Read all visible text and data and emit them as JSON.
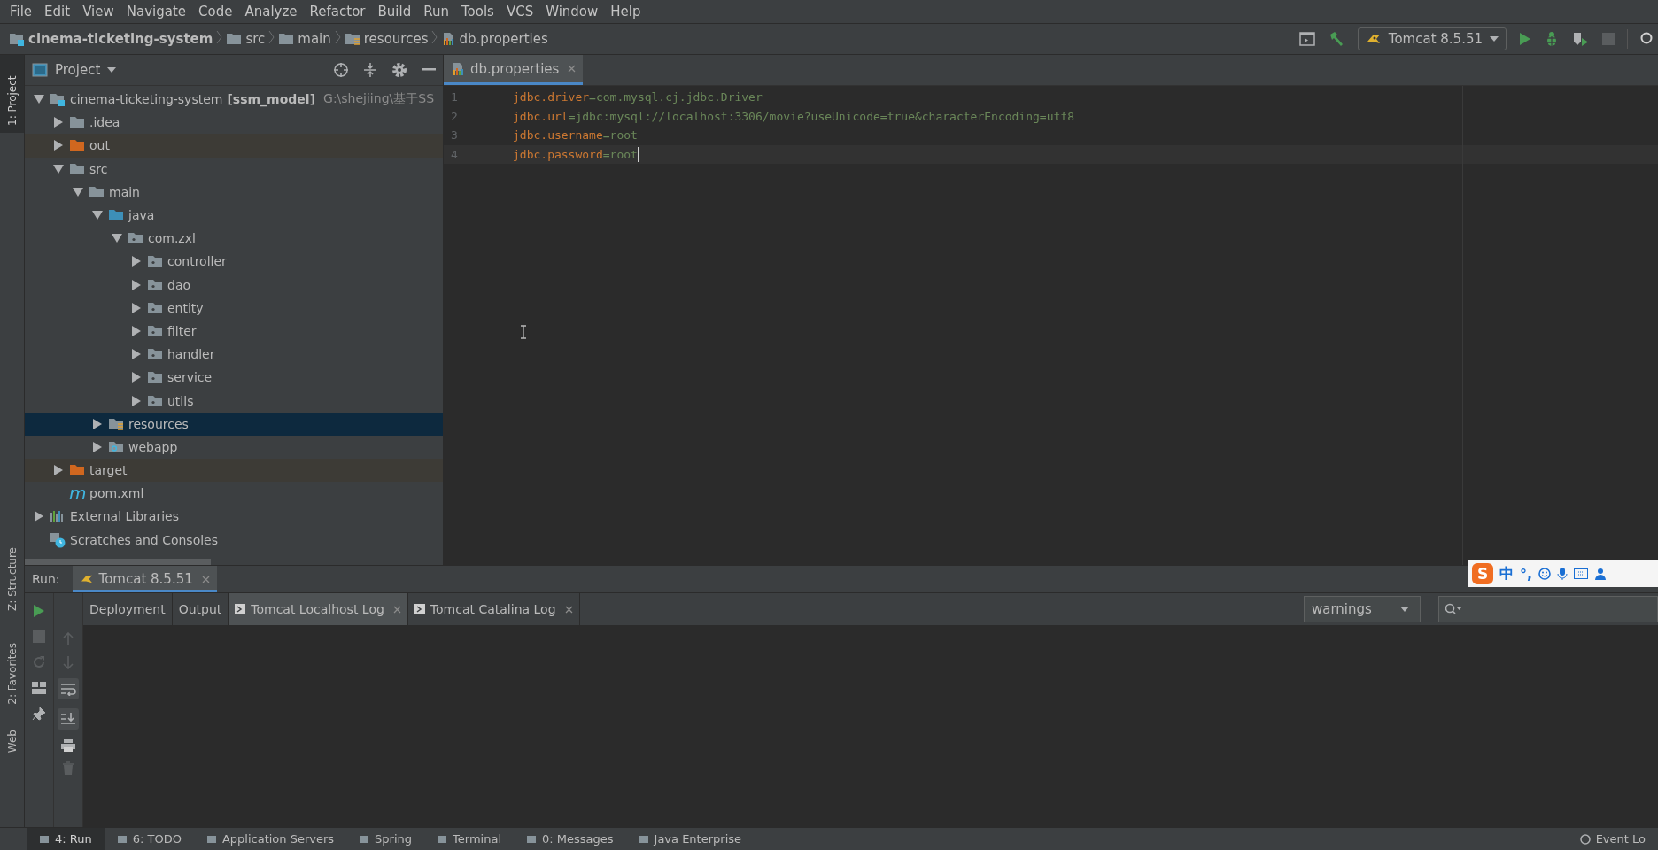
{
  "menu": [
    "File",
    "Edit",
    "View",
    "Navigate",
    "Code",
    "Analyze",
    "Refactor",
    "Build",
    "Run",
    "Tools",
    "VCS",
    "Window",
    "Help"
  ],
  "breadcrumbs": [
    {
      "label": "cinema-ticketing-system",
      "kind": "module"
    },
    {
      "label": "src",
      "kind": "folder"
    },
    {
      "label": "main",
      "kind": "folder"
    },
    {
      "label": "resources",
      "kind": "resources"
    },
    {
      "label": "db.properties",
      "kind": "properties"
    }
  ],
  "run_config": {
    "label": "Tomcat 8.5.51"
  },
  "side_tabs_left": [
    {
      "label": "1: Project",
      "selected": true
    },
    {
      "label": "Z: Structure",
      "selected": false
    },
    {
      "label": "2: Favorites",
      "selected": false
    },
    {
      "label": "Web",
      "selected": false
    }
  ],
  "project_panel": {
    "title": "Project",
    "tree": [
      {
        "name": "cinema-ticketing-system",
        "kind": "module",
        "module_tag": "[ssm_model]",
        "path": "G:\\shejiing\\基于SS",
        "expanded": true,
        "selected": false,
        "children": [
          {
            "name": ".idea",
            "kind": "folder",
            "expanded": false,
            "selected": false
          },
          {
            "name": "out",
            "kind": "excluded",
            "expanded": false,
            "selected": false
          },
          {
            "name": "src",
            "kind": "folder",
            "expanded": true,
            "selected": false,
            "children": [
              {
                "name": "main",
                "kind": "folder",
                "expanded": true,
                "selected": false,
                "children": [
                  {
                    "name": "java",
                    "kind": "source",
                    "expanded": true,
                    "selected": false,
                    "children": [
                      {
                        "name": "com.zxl",
                        "kind": "package",
                        "expanded": true,
                        "selected": false,
                        "children": [
                          {
                            "name": "controller",
                            "kind": "package",
                            "expanded": false,
                            "selected": false
                          },
                          {
                            "name": "dao",
                            "kind": "package",
                            "expanded": false,
                            "selected": false
                          },
                          {
                            "name": "entity",
                            "kind": "package",
                            "expanded": false,
                            "selected": false
                          },
                          {
                            "name": "filter",
                            "kind": "package",
                            "expanded": false,
                            "selected": false
                          },
                          {
                            "name": "handler",
                            "kind": "package",
                            "expanded": false,
                            "selected": false
                          },
                          {
                            "name": "service",
                            "kind": "package",
                            "expanded": false,
                            "selected": false
                          },
                          {
                            "name": "utils",
                            "kind": "package",
                            "expanded": false,
                            "selected": false
                          }
                        ]
                      }
                    ]
                  },
                  {
                    "name": "resources",
                    "kind": "resources",
                    "expanded": false,
                    "selected": true
                  },
                  {
                    "name": "webapp",
                    "kind": "web",
                    "expanded": false,
                    "selected": false
                  }
                ]
              }
            ]
          },
          {
            "name": "target",
            "kind": "excluded",
            "expanded": false,
            "selected": false
          },
          {
            "name": "pom.xml",
            "kind": "maven",
            "icon_text": "m",
            "selected": false
          }
        ]
      },
      {
        "name": "External Libraries",
        "kind": "libraries",
        "expanded": false,
        "selected": false
      },
      {
        "name": "Scratches and Consoles",
        "kind": "scratches",
        "selected": false
      }
    ]
  },
  "editor": {
    "tabs": [
      {
        "label": "db.properties",
        "selected": true
      }
    ],
    "lines": [
      {
        "number": "1",
        "key": "jdbc.driver",
        "operator": "=",
        "value": "com.mysql.cj.jdbc.Driver",
        "current": false
      },
      {
        "number": "2",
        "key": "jdbc.url",
        "operator": "=",
        "value": "jdbc:mysql://localhost:3306/movie?useUnicode=true&characterEncoding=utf8",
        "current": false
      },
      {
        "number": "3",
        "key": "jdbc.username",
        "operator": "=",
        "value": "root",
        "current": false
      },
      {
        "number": "4",
        "key": "jdbc.password",
        "operator": "=",
        "value": "root",
        "current": true
      }
    ]
  },
  "run_panel": {
    "label": "Run:",
    "tabs": [
      {
        "label": "Tomcat 8.5.51",
        "selected": true
      }
    ],
    "log_tabs": [
      {
        "label": "Deployment",
        "selected": false,
        "closable": false
      },
      {
        "label": "Output",
        "selected": false,
        "closable": false
      },
      {
        "label": "Tomcat Localhost Log",
        "selected": true,
        "closable": true
      },
      {
        "label": "Tomcat Catalina Log",
        "selected": false,
        "closable": true
      }
    ],
    "filter": "warnings"
  },
  "ime_toolbar": {
    "logo": "S",
    "mode": "中",
    "punct": "°,"
  },
  "bottom_tabs": [
    {
      "label": "4: Run",
      "selected": true
    },
    {
      "label": "6: TODO",
      "selected": false
    },
    {
      "label": "Application Servers",
      "selected": false
    },
    {
      "label": "Spring",
      "selected": false
    },
    {
      "label": "Terminal",
      "selected": false
    },
    {
      "label": "0: Messages",
      "selected": false
    },
    {
      "label": "Java Enterprise",
      "selected": false
    }
  ],
  "event_log": "Event Lo"
}
